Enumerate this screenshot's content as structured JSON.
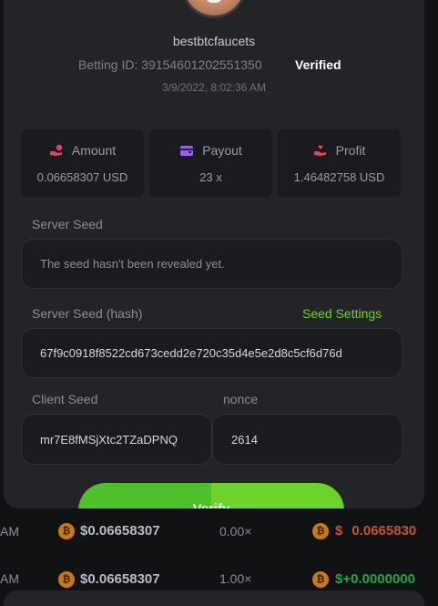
{
  "modal": {
    "username": "bestbtcfaucets",
    "betting_id_label": "Betting ID: 39154601202551350",
    "verified": "Verified",
    "date": "3/9/2022, 8:02:36 AM",
    "stats": [
      {
        "label": "Amount",
        "value": "0.06658307 USD",
        "icon": "hand-coin-icon",
        "color": "#e0435a"
      },
      {
        "label": "Payout",
        "value": "23 x",
        "icon": "wallet-icon",
        "color": "#9b5cf0"
      },
      {
        "label": "Profit",
        "value": "1.46482758 USD",
        "icon": "hand-heart-icon",
        "color": "#e0435a"
      }
    ],
    "server_seed_label": "Server Seed",
    "server_seed_value": "The seed hasn't been revealed yet.",
    "server_hash_label": "Server Seed (hash)",
    "seed_settings": "Seed Settings",
    "server_hash_value": "67f9c0918f8522cd673cedd2e720c35d4e5e2d8c5cf6d76d",
    "client_seed_label": "Client Seed",
    "client_seed_value": "mr7E8fMSjXtc2TZaDPNQ",
    "nonce_label": "nonce",
    "nonce_value": "2614",
    "verify_button": "Verify"
  },
  "background_rows": [
    {
      "time": "AM",
      "amount": "$0.06658307",
      "multiplier": "0.00×",
      "profit_sign": "$",
      "profit": "0.0665830",
      "profit_color": "#c0562a"
    },
    {
      "time": "AM",
      "amount": "$0.06658307",
      "multiplier": "1.00×",
      "profit_sign": "$+",
      "profit": "0.0000000",
      "profit_color": "#22a648"
    }
  ]
}
